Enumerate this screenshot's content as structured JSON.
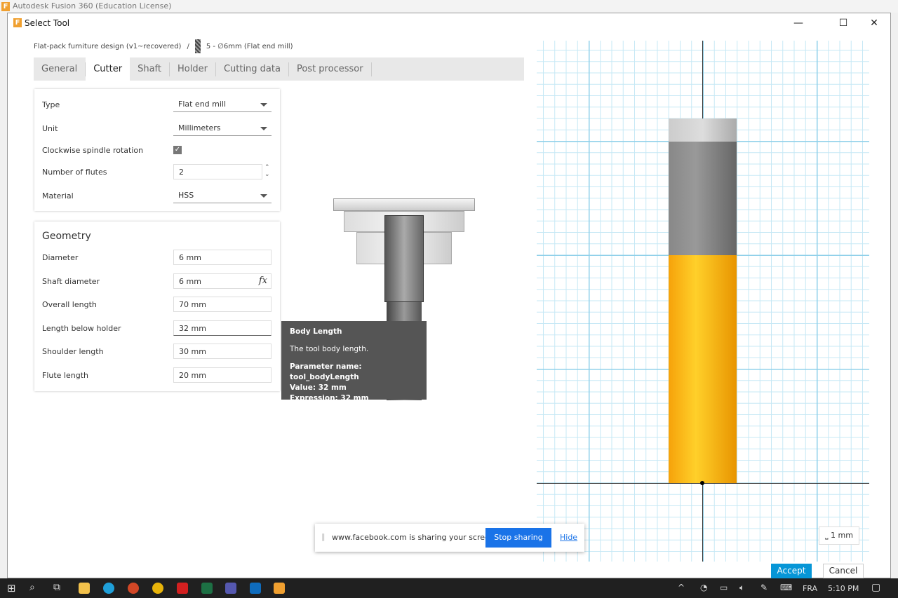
{
  "app_title": "Autodesk Fusion 360 (Education License)",
  "dialog": {
    "title": "Select Tool"
  },
  "breadcrumb": {
    "document": "Flat-pack furniture design (v1~recovered)",
    "separator": "/",
    "tool": "5 - ∅6mm (Flat end mill)"
  },
  "tabs": [
    {
      "label": "General"
    },
    {
      "label": "Cutter",
      "active": true
    },
    {
      "label": "Shaft"
    },
    {
      "label": "Holder"
    },
    {
      "label": "Cutting data"
    },
    {
      "label": "Post processor"
    }
  ],
  "cutter": {
    "type": {
      "label": "Type",
      "value": "Flat end mill"
    },
    "unit": {
      "label": "Unit",
      "value": "Millimeters"
    },
    "clockwise": {
      "label": "Clockwise spindle rotation",
      "checked": true
    },
    "flutes": {
      "label": "Number of flutes",
      "value": "2"
    },
    "material": {
      "label": "Material",
      "value": "HSS"
    }
  },
  "geometry": {
    "title": "Geometry",
    "diameter": {
      "label": "Diameter",
      "value": "6 mm"
    },
    "shaft_diameter": {
      "label": "Shaft diameter",
      "value": "6 mm",
      "fx": "fx"
    },
    "overall_length": {
      "label": "Overall length",
      "value": "70 mm"
    },
    "length_below_holder": {
      "label": "Length below holder",
      "value": "32 mm"
    },
    "shoulder_length": {
      "label": "Shoulder length",
      "value": "30 mm"
    },
    "flute_length": {
      "label": "Flute length",
      "value": "20 mm"
    }
  },
  "tooltip": {
    "title": "Body Length",
    "desc": "The tool body length.",
    "param": "Parameter name: tool_bodyLength",
    "value": "Value: 32 mm",
    "expr": "Expression: 32 mm"
  },
  "viewport": {
    "scale": "1 mm",
    "tool_color": "#ffb419"
  },
  "share_bar": {
    "text": "www.facebook.com is sharing your screen.",
    "stop": "Stop sharing",
    "hide": "Hide"
  },
  "buttons": {
    "accept": "Accept",
    "cancel": "Cancel"
  },
  "taskbar": {
    "language": "FRA",
    "time": "5:10 PM"
  }
}
